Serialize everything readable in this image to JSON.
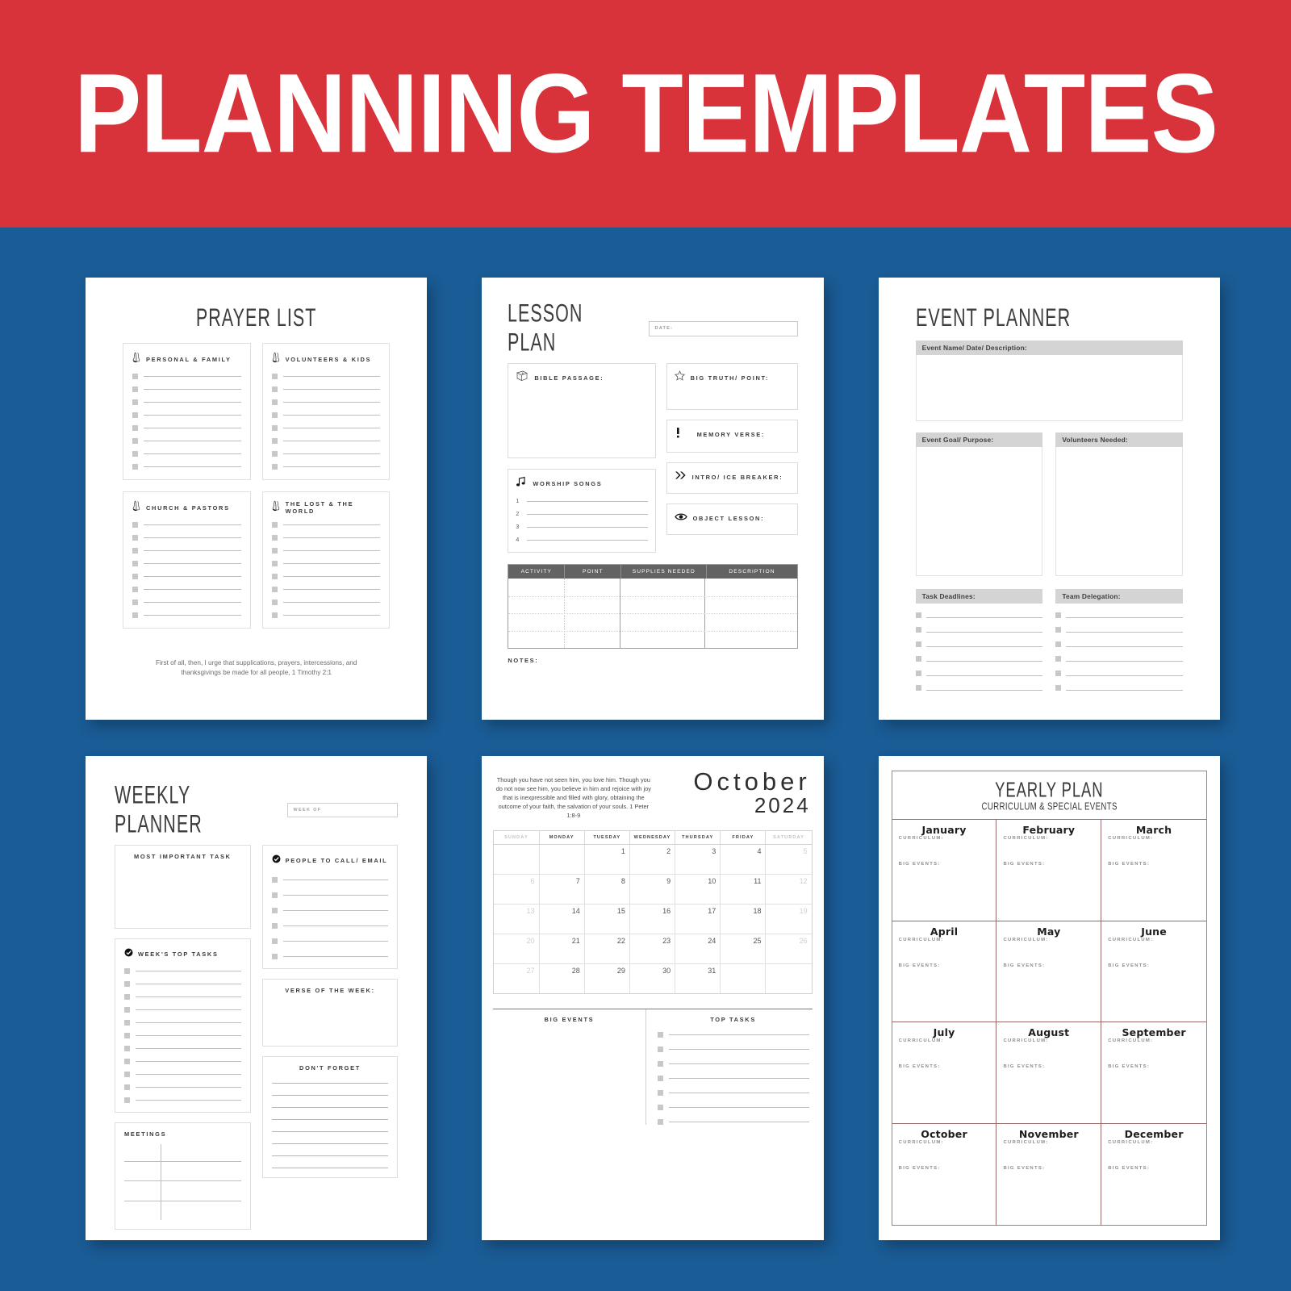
{
  "banner": {
    "title": "PLANNING TEMPLATES",
    "bg_color": "#d8333a",
    "text_color": "#ffffff"
  },
  "background_color": "#1a5c96",
  "spine_color": "#d8333a",
  "pages": {
    "prayer_list": {
      "title": "PRAYER LIST",
      "icon": "praying-hands-icon",
      "cards": [
        {
          "label": "PERSONAL & FAMILY",
          "lines": 8
        },
        {
          "label": "VOLUNTEERS & KIDS",
          "lines": 8
        },
        {
          "label": "CHURCH & PASTORS",
          "lines": 8
        },
        {
          "label": "THE LOST & THE WORLD",
          "lines": 8
        }
      ],
      "footer_verse": "First of all, then, I urge that supplications, prayers, intercessions, and thanksgivings be made for all people, 1 Timothy 2:1"
    },
    "lesson_plan": {
      "title": "LESSON PLAN",
      "date_label": "DATE:",
      "bible_passage_label": "BIBLE PASSAGE:",
      "bible_passage_icon": "bible-book-icon",
      "worship_songs_label": "WORSHIP SONGS",
      "worship_songs_icon": "music-note-icon",
      "song_numbers": [
        "1",
        "2",
        "3",
        "4"
      ],
      "big_truth_label": "BIG TRUTH/ POINT:",
      "big_truth_icon": "star-icon",
      "memory_verse_label": "MEMORY VERSE:",
      "memory_verse_icon": "exclamation-icon",
      "intro_label": "INTRO/ ICE BREAKER:",
      "intro_icon": "double-chevron-right-icon",
      "object_lesson_label": "OBJECT LESSON:",
      "object_lesson_icon": "eye-icon",
      "table_headers": [
        "ACTIVITY",
        "POINT",
        "SUPPLIES NEEDED",
        "DESCRIPTION"
      ],
      "notes_label": "NOTES:"
    },
    "event_planner": {
      "title": "EVENT PLANNER",
      "event_name_label": "Event Name/ Date/ Description:",
      "event_goal_label": "Event Goal/ Purpose:",
      "volunteers_label": "Volunteers Needed:",
      "task_deadlines_label": "Task Deadlines:",
      "team_delegation_label": "Team Delegation:",
      "list_rows": 6
    },
    "weekly_planner": {
      "title": "WEEKLY PLANNER",
      "week_of_label": "WEEK OF",
      "most_important_task_label": "MOST IMPORTANT TASK",
      "weeks_top_tasks_label": "WEEK'S TOP TASKS",
      "weeks_top_tasks_icon": "check-circle-icon",
      "weeks_top_tasks_rows": 11,
      "meetings_label": "MEETINGS",
      "people_to_call_label": "PEOPLE TO CALL/ EMAIL",
      "people_to_call_icon": "check-circle-icon",
      "people_to_call_rows": 6,
      "verse_of_week_label": "VERSE OF THE WEEK:",
      "dont_forget_label": "DON'T FORGET",
      "dont_forget_rows": 8
    },
    "calendar": {
      "verse": "Though you have not seen him, you love him. Though you do not now see him, you believe in him and rejoice with joy that is inexpressible and filled with glory, obtaining the outcome of your faith, the salvation of your souls. 1 Peter 1:8-9",
      "month": "October",
      "year": "2024",
      "day_headers": [
        "SUNDAY",
        "MONDAY",
        "TUESDAY",
        "WEDNESDAY",
        "THURSDAY",
        "FRIDAY",
        "SATURDAY"
      ],
      "weeks": [
        [
          "",
          "",
          "1",
          "2",
          "3",
          "4",
          "5"
        ],
        [
          "6",
          "7",
          "8",
          "9",
          "10",
          "11",
          "12"
        ],
        [
          "13",
          "14",
          "15",
          "16",
          "17",
          "18",
          "19"
        ],
        [
          "20",
          "21",
          "22",
          "23",
          "24",
          "25",
          "26"
        ],
        [
          "27",
          "28",
          "29",
          "30",
          "31",
          "",
          ""
        ]
      ],
      "big_events_label": "BIG EVENTS",
      "top_tasks_label": "TOP TASKS",
      "top_tasks_rows": 7
    },
    "yearly_plan": {
      "title": "YEARLY PLAN",
      "subtitle": "CURRICULUM & SPECIAL EVENTS",
      "curriculum_label": "CURRICULUM:",
      "big_events_label": "BIG EVENTS:",
      "months": [
        "January",
        "February",
        "March",
        "April",
        "May",
        "June",
        "July",
        "August",
        "September",
        "October",
        "November",
        "December"
      ]
    }
  }
}
